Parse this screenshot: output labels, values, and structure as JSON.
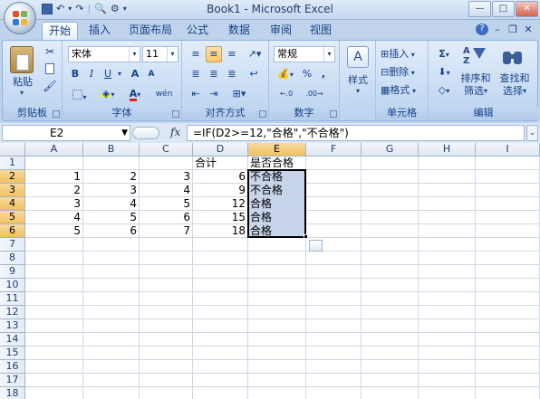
{
  "window": {
    "title": "Book1 - Microsoft Excel",
    "minimize": "—",
    "maximize": "□",
    "close": "✕"
  },
  "tabs": [
    "开始",
    "插入",
    "页面布局",
    "公式",
    "数据",
    "审阅",
    "视图"
  ],
  "active_tab": "开始",
  "ribbon": {
    "clipboard": {
      "label": "剪贴板",
      "paste": "粘贴"
    },
    "font": {
      "label": "字体",
      "font_name": "宋体",
      "font_size": "11",
      "bold": "B",
      "italic": "I",
      "underline": "U",
      "grow": "A",
      "shrink": "A",
      "font_color_letter": "A",
      "wen": "wén"
    },
    "alignment": {
      "label": "对齐方式"
    },
    "number": {
      "label": "数字",
      "format": "常规",
      "percent": "%",
      "comma": ","
    },
    "styles": {
      "label": "样式"
    },
    "cells": {
      "label": "单元格",
      "insert": "插入",
      "delete": "删除",
      "format": "格式"
    },
    "editing": {
      "label": "编辑",
      "sum": "Σ",
      "sort_filter": "排序和\n筛选",
      "find_select": "查找和\n选择",
      "sort_line1": "排序和",
      "sort_line2": "筛选",
      "find_line1": "查找和",
      "find_line2": "选择"
    }
  },
  "formula_bar": {
    "name_box": "E2",
    "fx": "fx",
    "formula": "=IF(D2>=12,\"合格\",\"不合格\")"
  },
  "sheet": {
    "columns": [
      "A",
      "B",
      "C",
      "D",
      "E",
      "F",
      "G",
      "H",
      "I"
    ],
    "rows": [
      "1",
      "2",
      "3",
      "4",
      "5",
      "6",
      "7",
      "8",
      "9",
      "10",
      "11",
      "12",
      "13",
      "14",
      "15",
      "16",
      "17",
      "18"
    ],
    "cells": {
      "D1": "合计",
      "E1": "是否合格",
      "A2": "1",
      "B2": "2",
      "C2": "3",
      "D2": "6",
      "E2": "不合格",
      "A3": "2",
      "B3": "3",
      "C3": "4",
      "D3": "9",
      "E3": "不合格",
      "A4": "3",
      "B4": "4",
      "C4": "5",
      "D4": "12",
      "E4": "合格",
      "A5": "4",
      "B5": "5",
      "C5": "6",
      "D5": "15",
      "E5": "合格",
      "A6": "5",
      "B6": "6",
      "C6": "7",
      "D6": "18",
      "E6": "合格"
    },
    "selection": "E2:E6"
  },
  "colors": {
    "selection_border": "#000000",
    "selection_fill": "#c7d4ea",
    "header_selected": "#f1c15f"
  }
}
